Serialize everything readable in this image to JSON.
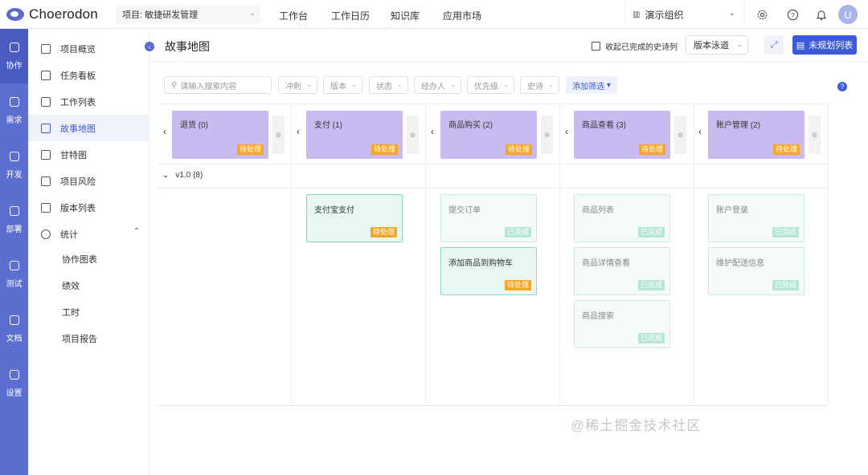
{
  "app": {
    "name": "Choerodon"
  },
  "topbar": {
    "project_label": "项目: 敏捷研发管理",
    "nav": [
      "工作台",
      "工作日历",
      "知识库",
      "应用市场"
    ],
    "org": "演示组织",
    "avatar_letter": "U"
  },
  "rail": [
    {
      "label": "协作",
      "icon": "cooperation-icon",
      "active": true
    },
    {
      "label": "需求",
      "icon": "requirement-icon"
    },
    {
      "label": "开发",
      "icon": "code-icon"
    },
    {
      "label": "部署",
      "icon": "deploy-icon"
    },
    {
      "label": "测试",
      "icon": "test-icon"
    },
    {
      "label": "文档",
      "icon": "document-icon"
    },
    {
      "label": "设置",
      "icon": "settings-icon"
    }
  ],
  "sidebar": {
    "items": [
      {
        "label": "项目概览",
        "icon": "overview-icon"
      },
      {
        "label": "任务看板",
        "icon": "board-icon"
      },
      {
        "label": "工作列表",
        "icon": "list-icon"
      },
      {
        "label": "故事地图",
        "icon": "map-icon",
        "active": true
      },
      {
        "label": "甘特图",
        "icon": "gantt-icon"
      },
      {
        "label": "项目风险",
        "icon": "risk-icon"
      },
      {
        "label": "版本列表",
        "icon": "version-icon"
      },
      {
        "label": "统计",
        "icon": "stats-icon"
      }
    ],
    "sub_items": [
      "协作图表",
      "绩效",
      "工时",
      "项目报告"
    ]
  },
  "header": {
    "title": "故事地图",
    "collapse_checkbox": "收起已完成的史诗列",
    "swimlane": "版本泳道",
    "unplanned_button": "未规划列表"
  },
  "filters": {
    "search_placeholder": "请输入搜索内容",
    "dropdowns": [
      "冲刺",
      "版本",
      "状态",
      "经办人",
      "优先级",
      "史诗"
    ],
    "add_filter": "添加筛选"
  },
  "epics": [
    {
      "title": "退货 (0)",
      "status": "待处理"
    },
    {
      "title": "支付 (1)",
      "status": "待处理"
    },
    {
      "title": "商品购买 (2)",
      "status": "待处理"
    },
    {
      "title": "商品查看 (3)",
      "status": "待处理"
    },
    {
      "title": "账户管理 (2)",
      "status": "待处理"
    }
  ],
  "version_row": {
    "label": "v1.0 (8)"
  },
  "stories": [
    [],
    [
      {
        "title": "支付宝支付",
        "status": "待处理"
      }
    ],
    [
      {
        "title": "提交订单",
        "status": "已完成"
      },
      {
        "title": "添加商品到购物车",
        "status": "待处理"
      }
    ],
    [
      {
        "title": "商品列表",
        "status": "已完成"
      },
      {
        "title": "商品详情查看",
        "status": "已完成"
      },
      {
        "title": "商品搜索",
        "status": "已完成"
      }
    ],
    [
      {
        "title": "账户登录",
        "status": "已完成"
      },
      {
        "title": "维护配送信息",
        "status": "已完成"
      }
    ]
  ],
  "watermark": "@稀土掘金技术社区",
  "colors": {
    "brand": "#5c6fd1",
    "epic": "#c9bbef",
    "todo": "#f5a623",
    "done": "#b6e6d7",
    "story_border": "#8ad6c3"
  }
}
